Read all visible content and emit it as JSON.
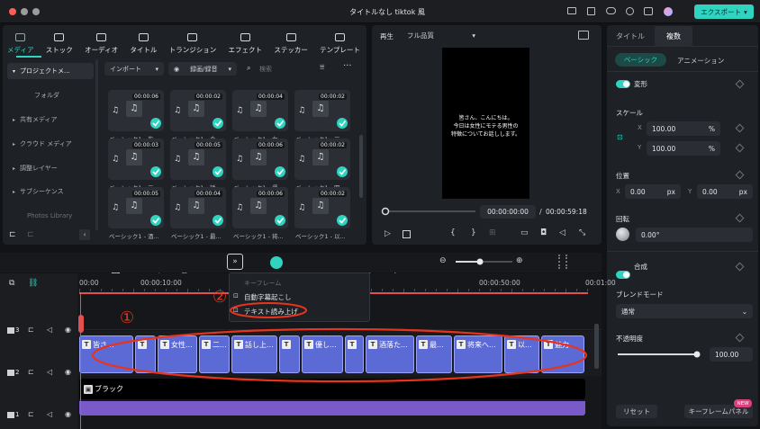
{
  "window": {
    "title": "タイトルなし tiktok 風",
    "export_label": "エクスポート"
  },
  "media_tabs": [
    {
      "label": "メディア",
      "icon": "media-icon",
      "active": true
    },
    {
      "label": "ストック",
      "icon": "stock-icon"
    },
    {
      "label": "オーディオ",
      "icon": "audio-icon"
    },
    {
      "label": "タイトル",
      "icon": "title-icon"
    },
    {
      "label": "トランジション",
      "icon": "transition-icon"
    },
    {
      "label": "エフェクト",
      "icon": "effect-icon"
    },
    {
      "label": "ステッカー",
      "icon": "sticker-icon"
    },
    {
      "label": "テンプレート",
      "icon": "template-icon"
    }
  ],
  "sidebar": {
    "items": [
      "プロジェクトメ...",
      "フォルダ",
      "共有メディア",
      "クラウド メディア",
      "調整レイヤー",
      "サブシーケンス",
      "Photos Library"
    ]
  },
  "library_toolbar": {
    "import_label": "インポート",
    "record_label": "録画/録音",
    "search_placeholder": "検索"
  },
  "media_items": [
    {
      "duration": "00:00:06",
      "label": "ベーシック1 - 皆..."
    },
    {
      "duration": "00:00:02",
      "label": "ベーシック1 - 今..."
    },
    {
      "duration": "00:00:04",
      "label": "ベーシック1 - 女..."
    },
    {
      "duration": "00:00:02",
      "label": "ベーシック1 - 三..."
    },
    {
      "duration": "00:00:03",
      "label": "ベーシック1 - 二..."
    },
    {
      "duration": "00:00:05",
      "label": "ベーシック1 - 話..."
    },
    {
      "duration": "00:00:06",
      "label": "ベーシック1 - 優..."
    },
    {
      "duration": "00:00:02",
      "label": "ベーシック1 - 四..."
    },
    {
      "duration": "00:00:05",
      "label": "ベーシック1 - 酒..."
    },
    {
      "duration": "00:00:04",
      "label": "ベーシック1 - 最..."
    },
    {
      "duration": "00:00:06",
      "label": "ベーシック1 - 将..."
    },
    {
      "duration": "00:00:02",
      "label": "ベーシック1 - 以..."
    }
  ],
  "preview": {
    "play_label": "再生",
    "quality": "フル品質",
    "caption": "皆さん、こんにちは。\n今日は女性にモテる男性の\n特徴についてお話しします。",
    "current_time": "00:00:00:00",
    "separator": "/",
    "total_time": "00:00:59:18",
    "playhead_fraction": 0.0
  },
  "timeline": {
    "ruler": [
      "00:00",
      "00:00:10:00",
      "00:00:50:00",
      "00:01:00"
    ],
    "popup": {
      "header": "キーフレーム",
      "items": [
        "自動字幕起こし",
        "テキスト読み上げ"
      ]
    },
    "annotations": [
      "①",
      "②"
    ],
    "tracks": [
      {
        "index": "3"
      },
      {
        "index": "2"
      },
      {
        "index": "1",
        "clip_label": "ブラック"
      }
    ],
    "text_clips": [
      "皆さ...",
      "",
      "女性...",
      "二...",
      "話し上...",
      "",
      "優し...",
      "",
      "酒落た...",
      "最...",
      "将来へ...",
      "以...",
      "魅力..."
    ]
  },
  "properties": {
    "tabs": [
      "タイトル",
      "複数"
    ],
    "subtabs": [
      "ベーシック",
      "アニメーション"
    ],
    "transform": "変形",
    "scale": "スケール",
    "scale_x": "100.00",
    "scale_y": "100.00",
    "percent": "%",
    "x_label": "X",
    "y_label": "Y",
    "position": "位置",
    "pos_x": "0.00",
    "pos_y": "0.00",
    "px": "px",
    "rotation": "回転",
    "rotation_value": "0.00°",
    "composite": "合成",
    "blend_mode_label": "ブレンドモード",
    "blend_mode": "通常",
    "opacity_label": "不透明度",
    "opacity": "100.00",
    "opacity_fraction": 1.0,
    "reset_label": "リセット",
    "keyframe_panel_label": "キーフレームパネル",
    "new_badge": "NEW"
  },
  "colors": {
    "accent": "#2fd3c0",
    "clip": "#5c6ad6",
    "annotation": "#e8341c"
  }
}
